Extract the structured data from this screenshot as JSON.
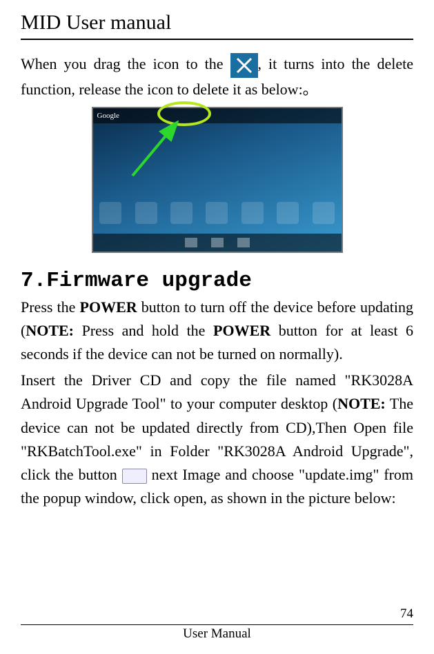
{
  "header": {
    "title": "MID User manual"
  },
  "body": {
    "p1a": "When you  drag  the  icon  to  the",
    "p1b": ",  it turns into  the delete function, release the icon to delete it as below:。",
    "section_heading": "7.Firmware upgrade",
    "p2a": "Press the ",
    "p2_power": "POWER",
    "p2b": " button to turn off the device before updating (",
    "p2_note1": "NOTE:",
    "p2c": " Press and hold the ",
    "p2_power2": "POWER",
    "p2d": " button for at least 6 seconds if the device can not be turned on normally).",
    "p3a": "Insert  the  Driver  CD  and  copy  the  file  named  \"RK3028A Android Upgrade Tool\" to your computer desktop (",
    "p3_note": "NOTE:",
    "p3b": " The device can not be updated directly from CD),Then Open file  \"RKBatchTool.exe\"  in  Folder  \"RK3028A  Android Upgrade\",  click  the  button ",
    "p3c": " next  Image  and  choose \"update.img\" from the popup window, click open, as shown in the picture below:"
  },
  "screenshot": {
    "search_label": "Google"
  },
  "footer": {
    "page_number": "74",
    "label": "User Manual"
  }
}
